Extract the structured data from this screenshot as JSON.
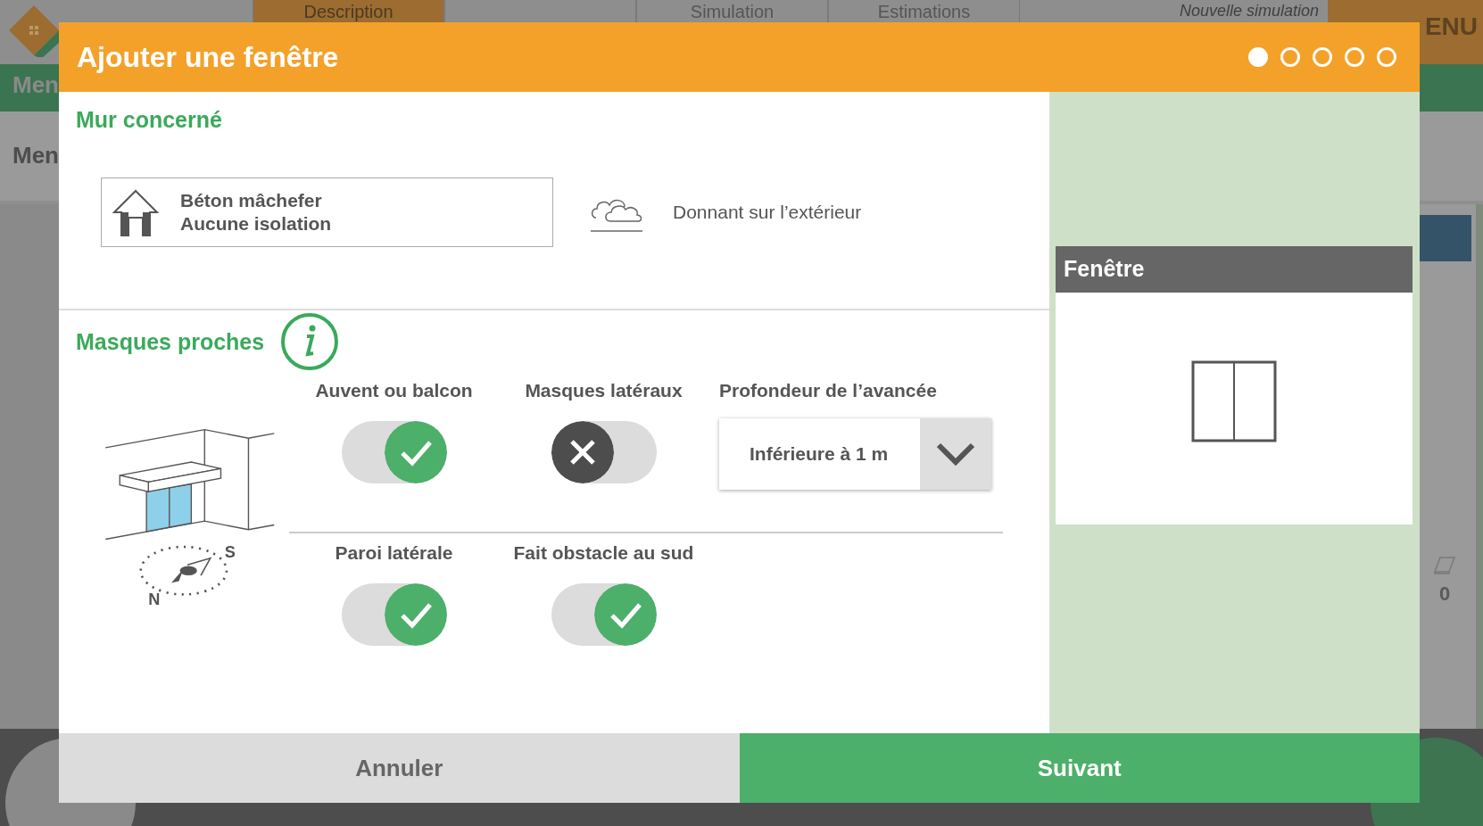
{
  "background": {
    "tabs": [
      {
        "label": "Description",
        "selected": true
      },
      {
        "selected": false
      },
      {
        "label": "Simulation",
        "selected": false
      },
      {
        "label": "Estimations",
        "selected": false
      }
    ],
    "simulation_name": "Nouvelle simulation",
    "menu_label": "ENU",
    "green_bar_label": "Men",
    "subheader_label": "Men",
    "side_counter": "0"
  },
  "dialog": {
    "title": "Ajouter une fenêtre",
    "steps": [
      {
        "selected": true
      },
      {
        "selected": false
      },
      {
        "selected": false
      },
      {
        "selected": false
      },
      {
        "selected": false
      }
    ],
    "wall": {
      "title": "Mur concerné",
      "card_lines": [
        "Béton mâchefer",
        "Aucune isolation"
      ],
      "exposure": "Donnant sur l’extérieur"
    },
    "masks": {
      "title": "Masques proches",
      "compass_labels": [
        "S",
        "N"
      ],
      "rows": [
        {
          "items": [
            {
              "kind": "toggle",
              "label": "Auvent ou balcon",
              "on": true
            },
            {
              "kind": "toggle",
              "label": "Masques latéraux",
              "on": false
            },
            {
              "kind": "dropdown",
              "label": "Profondeur de l’avancée",
              "value": "Inférieure à 1 m"
            }
          ]
        },
        {
          "items": [
            {
              "kind": "toggle",
              "label": "Paroi latérale",
              "on": true
            },
            {
              "kind": "toggle",
              "label": "Fait obstacle au sud",
              "on": true
            }
          ]
        }
      ]
    },
    "preview": {
      "title": "Fenêtre"
    },
    "buttons": {
      "cancel": "Annuler",
      "next": "Suivant"
    }
  }
}
